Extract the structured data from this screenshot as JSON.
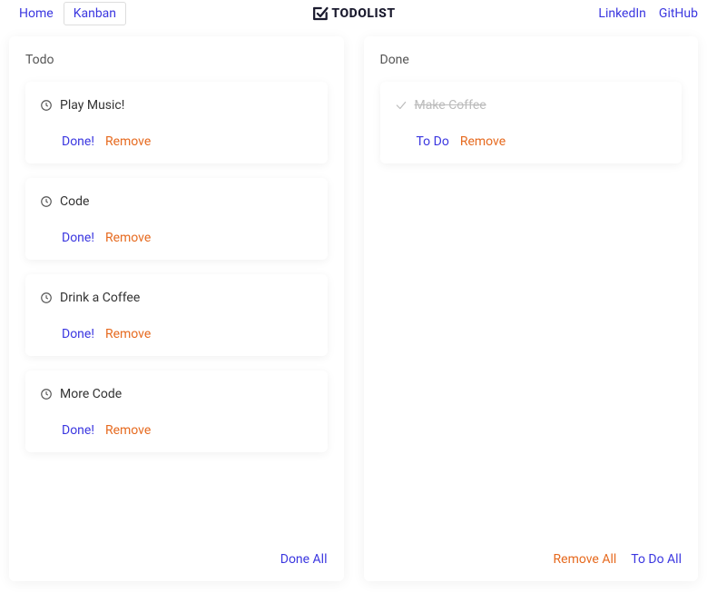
{
  "nav": {
    "home": "Home",
    "kanban": "Kanban",
    "linkedin": "LinkedIn",
    "github": "GitHub"
  },
  "logo": {
    "text": "TODOLIST"
  },
  "columns": {
    "todo": {
      "title": "Todo",
      "footer": {
        "done_all": "Done All"
      },
      "cards": [
        {
          "title": "Play Music!",
          "done_label": "Done!",
          "remove_label": "Remove"
        },
        {
          "title": "Code",
          "done_label": "Done!",
          "remove_label": "Remove"
        },
        {
          "title": "Drink a Coffee",
          "done_label": "Done!",
          "remove_label": "Remove"
        },
        {
          "title": "More Code",
          "done_label": "Done!",
          "remove_label": "Remove"
        }
      ]
    },
    "done": {
      "title": "Done",
      "footer": {
        "remove_all": "Remove All",
        "todo_all": "To Do All"
      },
      "cards": [
        {
          "title": "Make Coffee",
          "todo_label": "To Do",
          "remove_label": "Remove"
        }
      ]
    }
  }
}
